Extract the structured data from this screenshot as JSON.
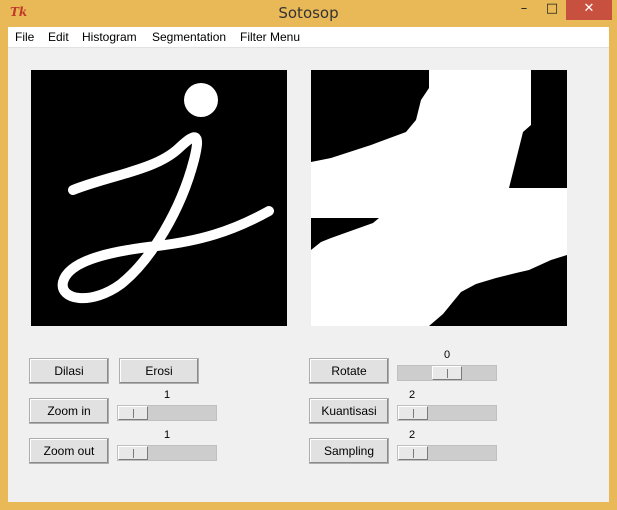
{
  "window": {
    "title": "Sotosop",
    "icon": "tk-feather-icon",
    "icon_text": "Tk",
    "minimize_glyph": "–",
    "maximize_glyph": "□",
    "close_glyph": "✕"
  },
  "menu": [
    "File",
    "Edit",
    "Histogram",
    "Segmentation",
    "Filter Menu"
  ],
  "buttons": {
    "dilasi": "Dilasi",
    "erosi": "Erosi",
    "zoom_in": "Zoom in",
    "zoom_out": "Zoom out",
    "rotate": "Rotate",
    "kuantisasi": "Kuantisasi",
    "sampling": "Sampling"
  },
  "scales": {
    "zoom_in": "1",
    "zoom_out": "1",
    "rotate": "0",
    "kuantisasi": "2",
    "sampling": "2"
  },
  "images": {
    "original": "handwritten-j-image",
    "result": "processed-zoom-image"
  }
}
